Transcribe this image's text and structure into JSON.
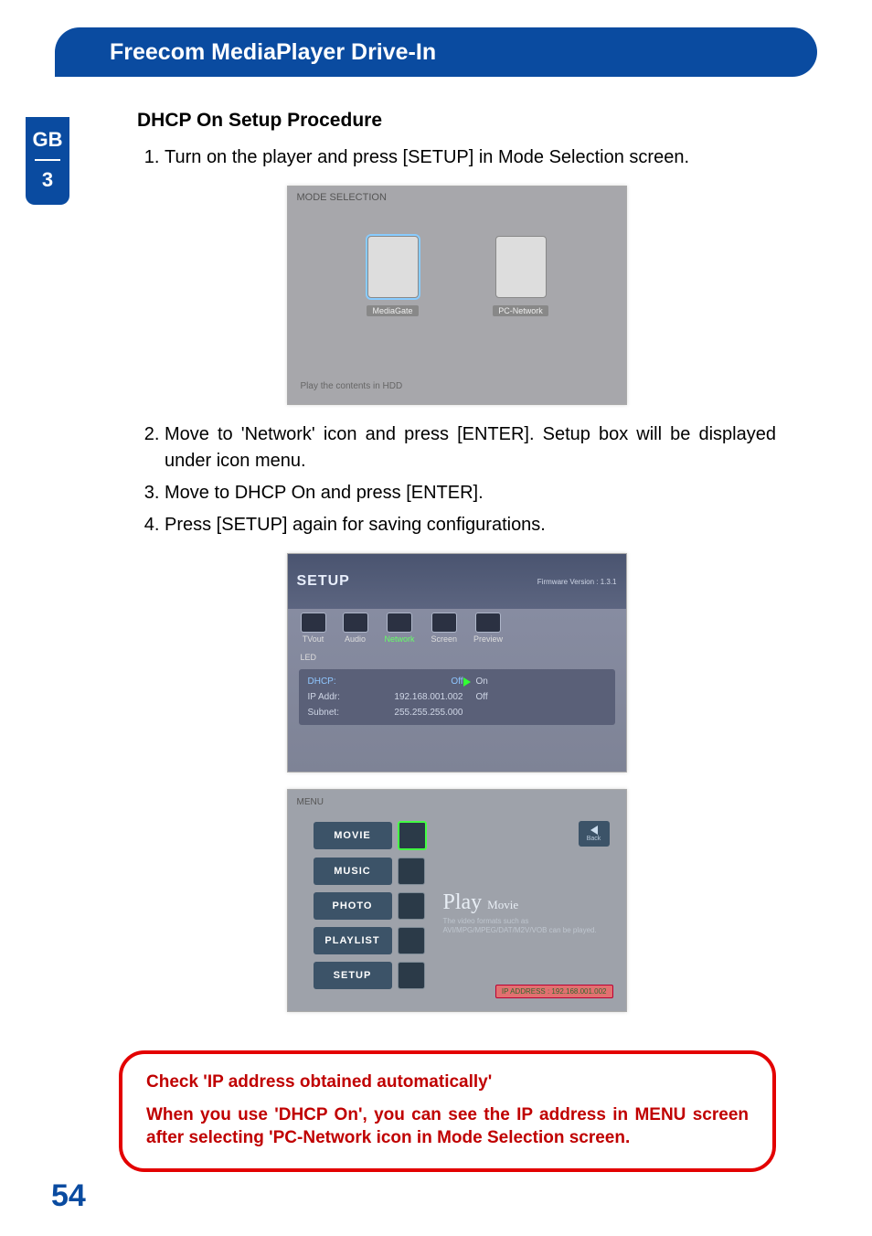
{
  "header": {
    "title": "Freecom MediaPlayer Drive-In"
  },
  "side_tab": {
    "lang": "GB",
    "chapter": "3"
  },
  "section_title": "DHCP On Setup Procedure",
  "steps": [
    "Turn on the player and press [SETUP] in Mode Selection screen.",
    "Move to 'Network' icon and press [ENTER]. Setup box will be displayed under icon menu.",
    "Move to DHCP On and press [ENTER].",
    "Press [SETUP] again for saving configurations."
  ],
  "shot1": {
    "title": "MODE SELECTION",
    "icon_a": "MediaGate",
    "icon_b": "PC-Network",
    "hint": "Play the contents in HDD"
  },
  "shot2": {
    "setup": "SETUP",
    "version": "Firmware Version : 1.3.1",
    "tabs": {
      "tvout": "TVout",
      "audio": "Audio",
      "network": "Network",
      "screen": "Screen",
      "preview": "Preview"
    },
    "led": "LED",
    "rows": {
      "dhcp_k": "DHCP:",
      "dhcp_v": "Off",
      "opt_on": "On",
      "opt_off": "Off",
      "ip_k": "IP Addr:",
      "ip_v": "192.168.001.002",
      "sub_k": "Subnet:",
      "sub_v": "255.255.255.000"
    }
  },
  "shot3": {
    "menu": "MENU",
    "items": {
      "movie": "MOVIE",
      "music": "MUSIC",
      "photo": "PHOTO",
      "playlist": "PLAYLIST",
      "setup": "SETUP"
    },
    "back": "Back",
    "play_big": "Play",
    "play_small": "Movie",
    "play_desc": "The video formats such as AVI/MPG/MPEG/DAT/M2V/VOB can be played.",
    "ip_label": "IP ADDRESS : 192.168.001.002"
  },
  "callout": {
    "line1": "Check 'IP address obtained automatically'",
    "line2": "When you use 'DHCP On', you can see the IP address in MENU screen after selecting 'PC-Network icon in Mode Selection screen."
  },
  "page_number": "54"
}
